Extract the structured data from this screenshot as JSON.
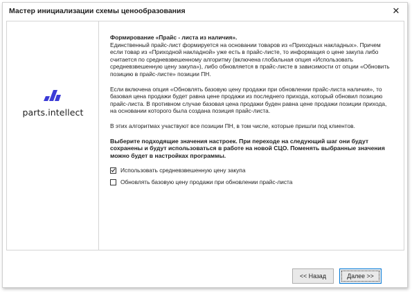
{
  "window": {
    "title": "Мастер инициализации схемы ценообразования",
    "close_glyph": "✕"
  },
  "brand": {
    "logo_text": "parts.intellect",
    "logo_color": "#3b3bd6"
  },
  "content": {
    "heading": "Формирование «Прайс - листа из наличия».",
    "para1": "Единственный прайс-лист формируется на основании товаров из «Приходных накладных». Причем если товар из «Приходной накладной» уже есть в прайс-листе, то информация о цене закупа либо считается по средневзвешенному алгоритму (включена глобальная опция «Использовать средневзвешенную цену закупа»), либо обновляется в прайс-листе в зависимости от опции «Обновить позицию в прайс-листе» позиции ПН.",
    "para2": "Если включена опция «Обновлять базовую цену продажи при обновлении прайс-листа наличия», то базовая цена продажи будет равна цене продажи из последнего прихода, который обновил позицию прайс-листа. В противном случае базовая цена продажи буден равна цене продажи позиции прихода, на основании которого была создана позиция прайс-листа.",
    "para3": "В этих алгоритмах участвуют все позиции ПН, в том числе, которые пришли под клиентов.",
    "para4": "Выберите подходящие значения настроек. При переходе на следующий шаг они будут сохранены и будут использоваться в работе на новой СЦО. Поменять выбранные значения можно будет в настройках программы."
  },
  "options": [
    {
      "label": "Использовать средневзвешенную цену закупа",
      "checked": true
    },
    {
      "label": "Обновлять базовую цену продажи при обновлении прайс-листа",
      "checked": false
    }
  ],
  "buttons": {
    "back": "<< Назад",
    "next": "Далее >>"
  }
}
